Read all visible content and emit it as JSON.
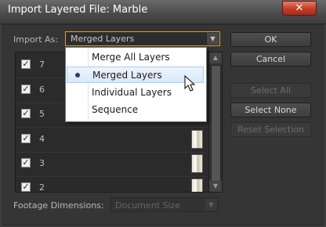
{
  "window": {
    "title": "Import Layered File: Marble",
    "close_symbol": "✕"
  },
  "import_as": {
    "label": "Import As:",
    "value": "Merged Layers"
  },
  "menu": {
    "items": [
      {
        "label": "Merge All Layers",
        "selected": false
      },
      {
        "label": "Merged Layers",
        "selected": true
      },
      {
        "label": "Individual Layers",
        "selected": false
      },
      {
        "label": "Sequence",
        "selected": false
      }
    ]
  },
  "buttons": {
    "ok": "OK",
    "cancel": "Cancel",
    "select_all": "Select All",
    "select_none": "Select None",
    "reset_selection": "Reset Selection"
  },
  "layers": [
    {
      "name": "7",
      "checked": true
    },
    {
      "name": "6",
      "checked": true
    },
    {
      "name": "5",
      "checked": true
    },
    {
      "name": "4",
      "checked": true
    },
    {
      "name": "3",
      "checked": true
    },
    {
      "name": "2",
      "checked": true
    }
  ],
  "footage": {
    "label": "Footage Dimensions:",
    "value": "Document Size"
  },
  "colors": {
    "accent_border": "#d6a03a",
    "close_red": "#c43b26",
    "selection": "#d8e8fb"
  },
  "icons": {
    "checkmark": "✓",
    "dropdown_arrow": "▼",
    "scroll_up": "▲",
    "scroll_down": "▼"
  }
}
